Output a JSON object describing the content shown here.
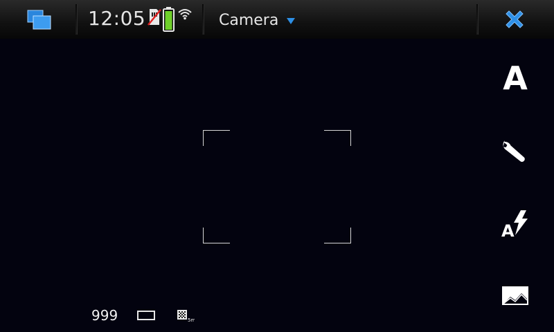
{
  "status": {
    "clock": "12:05",
    "app_title": "Camera"
  },
  "icons": {
    "task_switcher": "task-switcher-icon",
    "sim_status": "no-sim-icon",
    "battery": "battery-icon",
    "wifi": "wifi-icon",
    "close": "close-icon",
    "scene_mode": "scene-auto-icon",
    "settings": "wrench-icon",
    "flash": "flash-auto-icon",
    "gallery": "gallery-icon",
    "aspect": "aspect-ratio-icon",
    "resolution": "resolution-icon"
  },
  "sidebar": {
    "scene_mode_label": "A"
  },
  "info": {
    "shots_remaining": "999"
  },
  "colors": {
    "accent": "#2d8fe6",
    "battery_fill": "#6fd02a",
    "background": "#03030f"
  }
}
